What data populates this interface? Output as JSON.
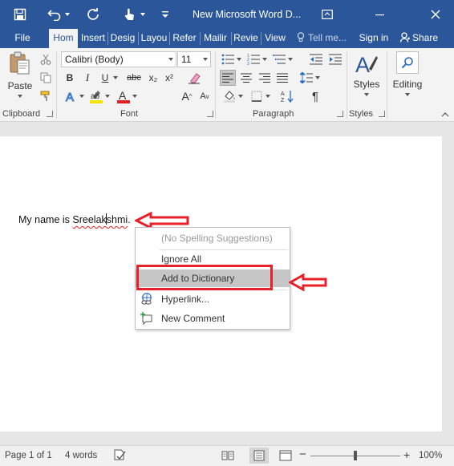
{
  "titlebar": {
    "title": "New Microsoft Word D...",
    "icons": [
      "save-icon",
      "undo-icon",
      "redo-icon",
      "touch-mode-icon",
      "customize-qat-icon"
    ],
    "controls": [
      "ribbon-display-options-icon",
      "minimize-icon",
      "close-icon"
    ]
  },
  "tabs": {
    "file": "File",
    "items": [
      "Hom",
      "Insert",
      "Desig",
      "Layou",
      "Refer",
      "Mailir",
      "Revie",
      "View"
    ],
    "tell_me": "Tell me...",
    "sign_in": "Sign in",
    "share": "Share"
  },
  "ribbon": {
    "clipboard": {
      "label": "Clipboard",
      "paste": "Paste"
    },
    "font": {
      "label": "Font",
      "font_name": "Calibri (Body)",
      "font_size": "11",
      "bold": "B",
      "italic": "I",
      "underline": "U",
      "strike": "abc",
      "subscript": "x₂",
      "superscript": "x²",
      "grow": "A",
      "shrink": "A",
      "aa": "Aa"
    },
    "paragraph": {
      "label": "Paragraph"
    },
    "styles": {
      "label": "Styles",
      "button": "Styles"
    },
    "editing": {
      "button": "Editing"
    }
  },
  "document": {
    "text_before": "My name is ",
    "misspelled_a": "Sreelak",
    "misspelled_b": "shmi",
    "text_after": "."
  },
  "context_menu": {
    "items": [
      {
        "label": "(No Spelling Suggestions)",
        "disabled": true
      },
      {
        "label": "Ignore All"
      },
      {
        "label": "Add to Dictionary",
        "highlighted": true
      },
      {
        "label": "Hyperlink...",
        "icon": "hyperlink-icon"
      },
      {
        "label": "New Comment",
        "icon": "new-comment-icon"
      }
    ]
  },
  "statusbar": {
    "page": "Page 1 of 1",
    "words": "4 words",
    "zoom": "100%"
  },
  "colors": {
    "accent": "#2b579a",
    "annotation_red": "#e8202a",
    "highlight_yellow": "#f5e400",
    "font_color_red": "#e02020"
  }
}
